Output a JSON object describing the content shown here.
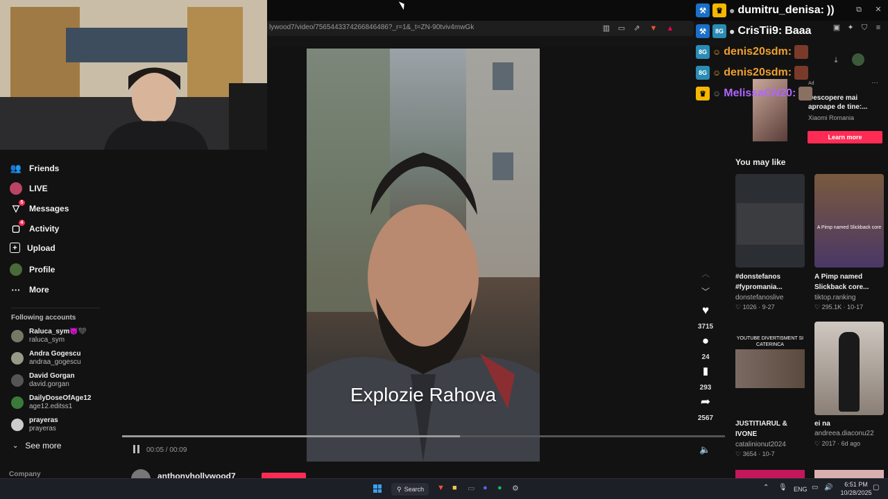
{
  "browser": {
    "url": "lywood7/video/7565443374266846486?_r=1&_t=ZN-90tviv4mwGk"
  },
  "sidebar": {
    "nav": [
      {
        "label": "Friends",
        "icon": "friends-icon"
      },
      {
        "label": "LIVE",
        "icon": "live-icon"
      },
      {
        "label": "Messages",
        "icon": "messages-icon",
        "badge": "5"
      },
      {
        "label": "Activity",
        "icon": "activity-icon",
        "badge": "4"
      },
      {
        "label": "Upload",
        "icon": "upload-icon"
      },
      {
        "label": "Profile",
        "icon": "profile-icon"
      },
      {
        "label": "More",
        "icon": "more-icon"
      }
    ],
    "following_title": "Following accounts",
    "accounts": [
      {
        "name": "Raluca_sym😈🖤",
        "handle": "raluca_sym"
      },
      {
        "name": "Andra Gogescu",
        "handle": "andraa_gogescu"
      },
      {
        "name": "David Gorgan",
        "handle": "david.gorgan"
      },
      {
        "name": "DailyDoseOfAge12",
        "handle": "age12.editss1"
      },
      {
        "name": "prayeras",
        "handle": "prayeras"
      }
    ],
    "see_more": "See more",
    "company": "Company"
  },
  "video": {
    "caption": "Explozie Rahova",
    "time": "00:05 / 00:09",
    "progress": 0.56,
    "author": "anthonyhollywood7"
  },
  "actions": {
    "likes": "3715",
    "comments": "24",
    "saves": "293",
    "shares": "2567"
  },
  "ad": {
    "title": "Descopere mai aproape de tine:...",
    "advertiser": "Xiaomi Romania",
    "cta": "Learn more",
    "tag": "Ad"
  },
  "suggestions": {
    "heading": "You may like",
    "items": [
      {
        "title": "#donstefanos #fypromania...",
        "user": "donstefanoslive",
        "likes": "1026",
        "date": "9-27"
      },
      {
        "title": "A Pimp named Slickback core...",
        "user": "tiktop.ranking",
        "likes": "295.1K",
        "date": "10-17",
        "thumb_text": "A Pimp named Slickback core"
      },
      {
        "title": "JUSTITIARUL & IVONE",
        "user": "catalinionut2024",
        "likes": "3654",
        "date": "10-7",
        "thumb_text": "YOUTUBE DIVERTISMENT SI CATERINCA"
      },
      {
        "title": "ei na",
        "user": "andreea.diaconu22",
        "likes": "2017",
        "date": "6d ago"
      }
    ]
  },
  "chat": [
    {
      "user": "dumitru_denisa:",
      "msg": "))",
      "color": "#ffffff"
    },
    {
      "user": "CrisTii9:",
      "msg": "Baaa",
      "color": "#ffffff"
    },
    {
      "user": "denis20sdm:",
      "msg": "",
      "color": "#f0a030"
    },
    {
      "user": "denis20sdm:",
      "msg": "",
      "color": "#f0a030"
    },
    {
      "user": "MelissaCN20:",
      "msg": "",
      "color": "#b066ff"
    }
  ],
  "taskbar": {
    "search": "Search",
    "lang": "ENG",
    "time": "6:51 PM",
    "date": "10/28/2025"
  },
  "colors": {
    "accent": "#fe2c55",
    "bg": "#121212"
  }
}
